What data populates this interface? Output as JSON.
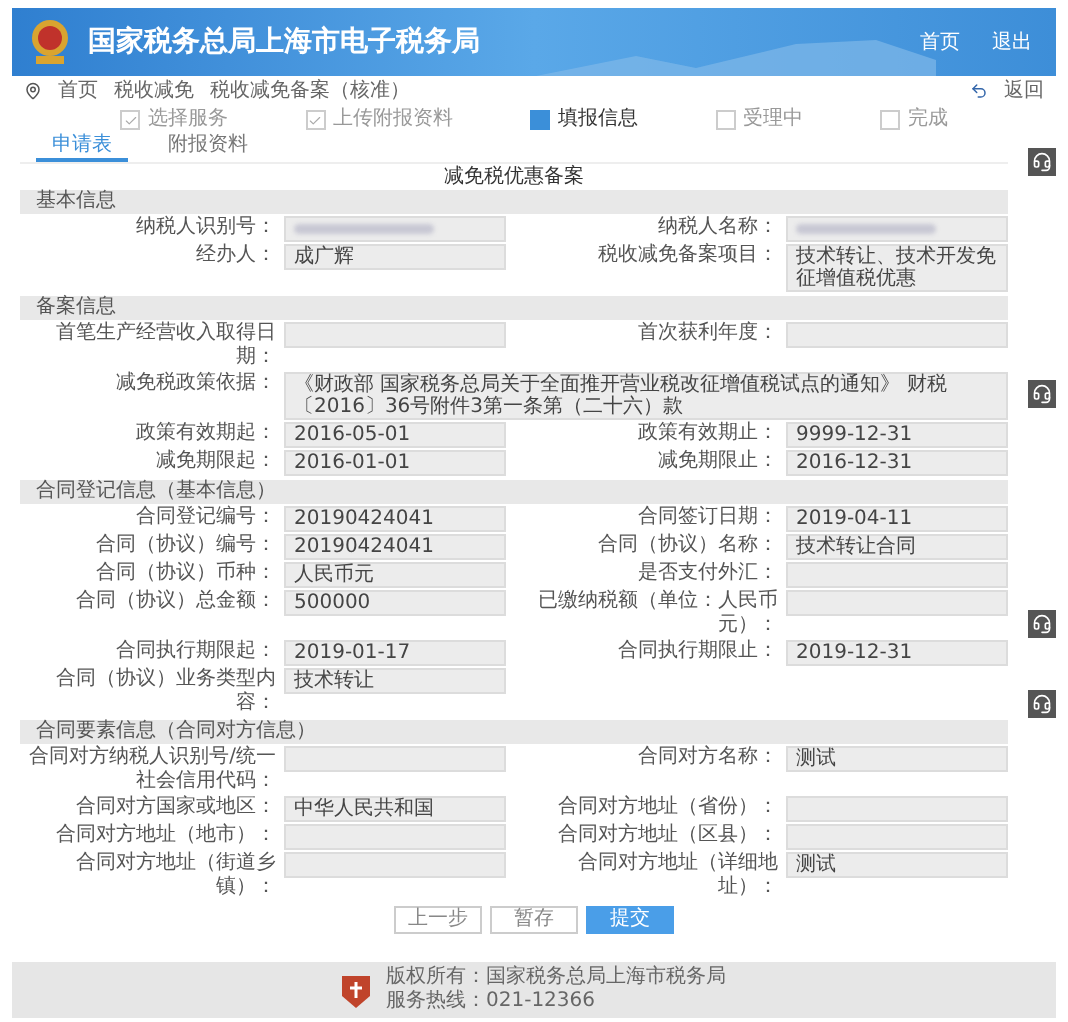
{
  "header": {
    "title": "国家税务总局上海市电子税务局",
    "links": [
      "首页",
      "退出"
    ]
  },
  "breadcrumb": {
    "items": [
      "首页",
      "税收减免",
      "税收减免备案（核准）"
    ],
    "back": "返回"
  },
  "steps": [
    {
      "label": "选择服务",
      "done": true,
      "selected": false
    },
    {
      "label": "上传附报资料",
      "done": true,
      "selected": false
    },
    {
      "label": "填报信息",
      "done": false,
      "selected": true
    },
    {
      "label": "受理中",
      "done": false,
      "selected": false
    },
    {
      "label": "完成",
      "done": false,
      "selected": false
    }
  ],
  "tabs": [
    {
      "label": "申请表",
      "selected": true
    },
    {
      "label": "附报资料",
      "selected": false
    }
  ],
  "form_title": "减免税优惠备案",
  "sections": [
    {
      "title": "基本信息",
      "fields": [
        {
          "kind": "redacted",
          "label": "纳税人识别号："
        },
        {
          "kind": "redacted",
          "label": "纳税人名称："
        },
        {
          "kind": "field",
          "label": "经办人：",
          "value": "成广辉"
        },
        {
          "kind": "field",
          "label": "税收减免备案项目：",
          "value": "技术转让、技术开发免征增值税优惠"
        }
      ]
    },
    {
      "title": "备案信息",
      "fields": [
        {
          "kind": "field",
          "label": "首笔生产经营收入取得日期："
        },
        {
          "kind": "field",
          "label": "首次获利年度："
        },
        {
          "kind": "wide",
          "label": "减免税政策依据：",
          "value": "《财政部 国家税务总局关于全面推开营业税改征增值税试点的通知》 财税〔2016〕36号附件3第一条第（二十六）款"
        },
        {
          "kind": "field",
          "label": "政策有效期起：",
          "value": "2016-05-01"
        },
        {
          "kind": "field",
          "label": "政策有效期止：",
          "value": "9999-12-31"
        },
        {
          "kind": "field",
          "label": "减免期限起：",
          "value": "2016-01-01"
        },
        {
          "kind": "field",
          "label": "减免期限止：",
          "value": "2016-12-31"
        }
      ]
    },
    {
      "title": "合同登记信息（基本信息）",
      "fields": [
        {
          "kind": "field",
          "label": "合同登记编号：",
          "value": "20190424041"
        },
        {
          "kind": "field",
          "label": "合同签订日期：",
          "value": "2019-04-11"
        },
        {
          "kind": "field",
          "label": "合同（协议）编号：",
          "value": "20190424041"
        },
        {
          "kind": "field",
          "label": "合同（协议）名称：",
          "value": "技术转让合同"
        },
        {
          "kind": "field",
          "label": "合同（协议）币种：",
          "value": "人民币元"
        },
        {
          "kind": "field",
          "label": "是否支付外汇："
        },
        {
          "kind": "field",
          "label": "合同（协议）总金额：",
          "value": "500000"
        },
        {
          "kind": "field",
          "label": "已缴纳税额（单位：人民币元）："
        },
        {
          "kind": "field",
          "label": "合同执行期限起：",
          "value": "2019-01-17"
        },
        {
          "kind": "field",
          "label": "合同执行期限止：",
          "value": "2019-12-31"
        },
        {
          "kind": "field",
          "label": "合同（协议）业务类型内容：",
          "value": "技术转让"
        }
      ]
    },
    {
      "title": "合同要素信息（合同对方信息）",
      "fields": [
        {
          "kind": "field",
          "label": "合同对方纳税人识别号/统一社会信用代码："
        },
        {
          "kind": "field",
          "label": "合同对方名称：",
          "value": "测试"
        },
        {
          "kind": "field",
          "label": "合同对方国家或地区：",
          "value": "中华人民共和国"
        },
        {
          "kind": "field",
          "label": "合同对方地址（省份）："
        },
        {
          "kind": "field",
          "label": "合同对方地址（地市）："
        },
        {
          "kind": "field",
          "label": "合同对方地址（区县）："
        },
        {
          "kind": "field",
          "label": "合同对方地址（街道乡镇）："
        },
        {
          "kind": "field",
          "label": "合同对方地址（详细地址）：",
          "value": "测试"
        }
      ]
    }
  ],
  "buttons": [
    {
      "label": "上一步",
      "kind": "secondary"
    },
    {
      "label": "暂存",
      "kind": "secondary"
    },
    {
      "label": "提交",
      "kind": "primary"
    }
  ],
  "footer": {
    "lines": [
      "版权所有：国家税务总局上海市税务局",
      "服务热线：021-12366"
    ]
  }
}
